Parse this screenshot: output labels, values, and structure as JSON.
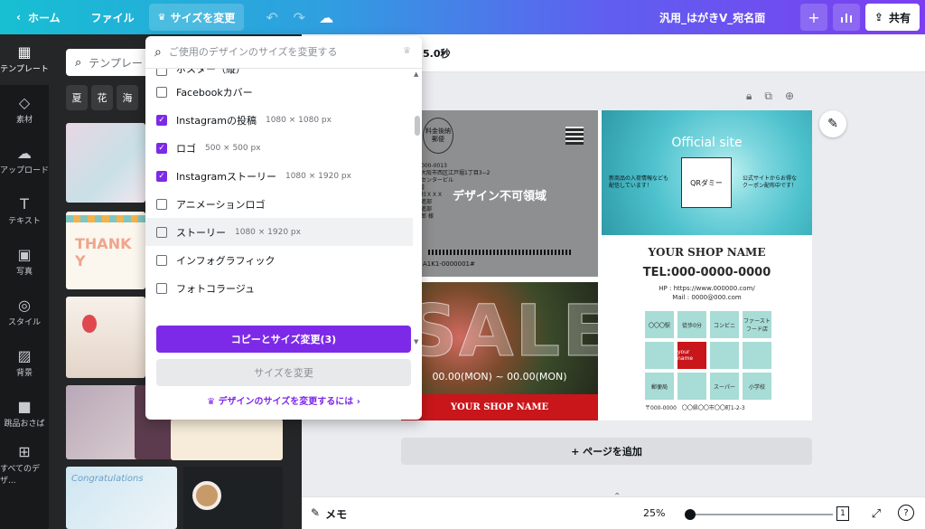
{
  "topbar": {
    "home": "ホーム",
    "file": "ファイル",
    "resize": "サイズを変更",
    "title": "汎用_はがきV_宛名面",
    "share": "共有"
  },
  "rail": [
    {
      "label": "テンプレート",
      "icon": "template-icon"
    },
    {
      "label": "素材",
      "icon": "elements-icon"
    },
    {
      "label": "アップロード",
      "icon": "upload-icon"
    },
    {
      "label": "テキスト",
      "icon": "text-icon"
    },
    {
      "label": "写真",
      "icon": "photo-icon"
    },
    {
      "label": "スタイル",
      "icon": "style-icon"
    },
    {
      "label": "背景",
      "icon": "background-icon"
    },
    {
      "label": "跳品おさば",
      "icon": "app-icon"
    },
    {
      "label": "すべてのデザ...",
      "icon": "all-designs-icon"
    }
  ],
  "panel": {
    "search_value": "テンプレー",
    "chips": [
      "夏",
      "花",
      "海"
    ]
  },
  "editor": {
    "duration": "5.0秒",
    "add_page": "+ ページを追加"
  },
  "bottombar": {
    "memo": "メモ",
    "zoom": "25%",
    "page_count": "1"
  },
  "dropdown": {
    "placeholder": "ご使用のデザインのサイズを変更する",
    "partial_item": "ポスター（縦）",
    "items": [
      {
        "label": "Facebookカバー",
        "size": "",
        "checked": false
      },
      {
        "label": "Instagramの投稿",
        "size": "1080 × 1080 px",
        "checked": true
      },
      {
        "label": "ロゴ",
        "size": "500 × 500 px",
        "checked": true
      },
      {
        "label": "Instagramストーリー",
        "size": "1080 × 1920 px",
        "checked": true
      },
      {
        "label": "アニメーションロゴ",
        "size": "",
        "checked": false
      },
      {
        "label": "ストーリー",
        "size": "1080 × 1920 px",
        "checked": false
      },
      {
        "label": "インフォグラフィック",
        "size": "",
        "checked": false
      },
      {
        "label": "フォトコラージュ",
        "size": "",
        "checked": false
      }
    ],
    "copy_resize": "コピーとサイズ変更(3)",
    "resize": "サイズを変更",
    "learn_link": "デザインのサイズを変更するには"
  },
  "design": {
    "stamp": "料金後納\n郵便",
    "address_lines": "〒000-0013\n府大阪市西区江戸堀1丁目3−2\n角センタービル\n3階\n会社ＸＸＸ\n推進部\n推進部\n一郎 様",
    "unavailable": "デザイン不可領域",
    "barcode_code": "A1K1-0000001#",
    "official": "Official site",
    "note_left": "新商品の入荷情報なども\n配信しています！",
    "note_right": "公式サイトからお得な\nクーポン配布中です！",
    "qr_label": "QRダミー",
    "shop_name": "YOUR SHOP NAME",
    "tel": "TEL:000-0000-0000",
    "hp": "HP : https://www.000000.com/",
    "mail": "Mail : 0000@000.com",
    "map_cells": [
      "〇〇〇駅",
      "徒歩0分",
      "コンビニ",
      "ファースト\nフード店",
      "",
      "your name",
      "",
      "",
      "郵便局",
      "",
      "スーパー",
      "小学校"
    ],
    "map_address": "〒000-0000　〇〇県〇〇市〇〇町1-2-3",
    "sale": "SALE",
    "sale_date": "00.00(MON) ~ 00.00(MON)",
    "sale_shop": "YOUR SHOP NAME"
  },
  "colors": {
    "accent": "#7d2ae8",
    "sale_red": "#c8161b",
    "map_teal": "#a8dcd6"
  }
}
